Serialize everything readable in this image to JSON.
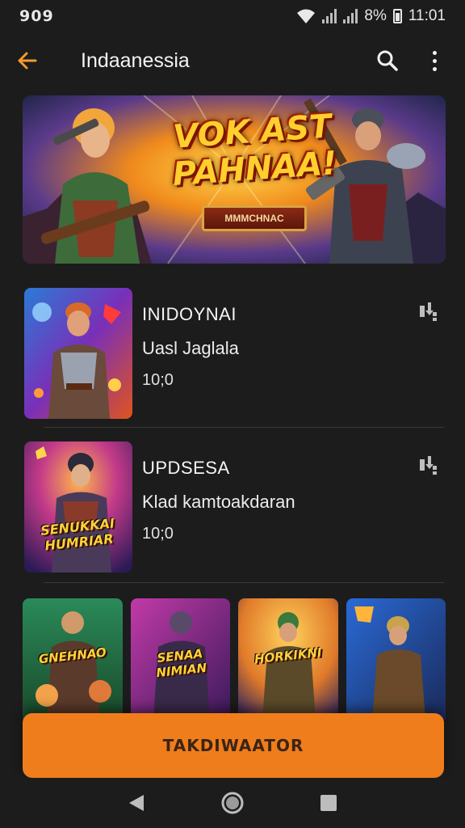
{
  "status_bar": {
    "left": "909",
    "battery": "8%",
    "time": "11:01"
  },
  "app_bar": {
    "title": "Indaanessia"
  },
  "banner": {
    "title_line1": "VOK AST",
    "title_line2": "PAHNAA!",
    "ribbon": "MMMCHNAC"
  },
  "list": [
    {
      "title": "INIDOYNAI",
      "subtitle": "Uasl Jaglala",
      "meta": "10;0",
      "thumb_label": ""
    },
    {
      "title": "UPDSESA",
      "subtitle": "Klad kamtoakdaran",
      "meta": "10;0",
      "thumb_label": "SENUKKAI HUMRIAR"
    }
  ],
  "tiles": [
    {
      "label": "GNEHNAO"
    },
    {
      "label": "SENAA NIMIAN"
    },
    {
      "label": "HORKIKNI"
    },
    {
      "label": ""
    }
  ],
  "primary_button": {
    "label": "TAKDIWAATOR"
  },
  "colors": {
    "accent": "#f07d1b",
    "background": "#1c1c1d",
    "back_arrow": "#f39a2d"
  },
  "icons": {
    "back": "arrow-left-icon",
    "search": "search-icon",
    "more": "more-vertical-icon",
    "item_menu": "download-icon"
  }
}
